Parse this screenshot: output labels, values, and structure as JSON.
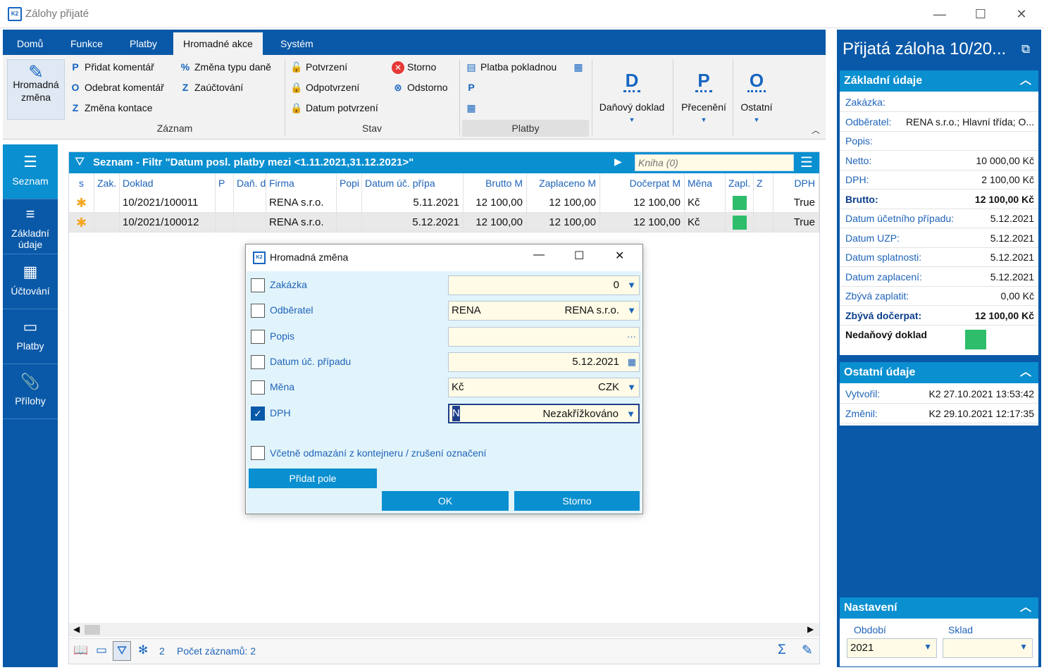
{
  "window": {
    "title": "Zálohy přijaté",
    "minimize": "—",
    "maximize": "☐",
    "close": "✕"
  },
  "tabs": [
    "Domů",
    "Funkce",
    "Platby",
    "Hromadné akce",
    "Systém"
  ],
  "ribbon": {
    "big_button": "Hromadná změna",
    "zaznam": [
      "Přidat komentář",
      "Odebrat komentář",
      "Změna kontace",
      "Změna typu daně",
      "Zaúčtování"
    ],
    "zaznam_label": "Záznam",
    "stav": [
      "Potvrzení",
      "Odpotvrzení",
      "Datum potvrzení",
      "Storno",
      "Odstorno"
    ],
    "stav_label": "Stav",
    "platby": [
      "Platba pokladnou"
    ],
    "platby_label": "Platby",
    "danovy": "Daňový doklad",
    "preceneni": "Přecenění",
    "ostatni": "Ostatní"
  },
  "leftnav": [
    "Seznam",
    "Základní údaje",
    "Účtování",
    "Platby",
    "Přílohy"
  ],
  "list": {
    "filter_title": "Seznam - Filtr \"Datum posl. platby mezi <1.11.2021,31.12.2021>\"",
    "search_placeholder": "Kniha (0)",
    "columns": [
      "s",
      "Zak.",
      "Doklad",
      "P",
      "Daň. dol",
      "Firma",
      "Popi",
      "Datum úč. přípa",
      "Brutto M",
      "Zaplaceno M",
      "Dočerpat M",
      "Měna",
      "Zapl.",
      "Z",
      "DPH"
    ],
    "rows": [
      {
        "doklad": "10/2021/100011",
        "firma": "RENA s.r.o.",
        "datum": "5.11.2021",
        "brutto": "12 100,00",
        "zaplaceno": "12 100,00",
        "docerpat": "12 100,00",
        "mena": "Kč",
        "dph": "True"
      },
      {
        "doklad": "10/2021/100012",
        "firma": "RENA s.r.o.",
        "datum": "5.12.2021",
        "brutto": "12 100,00",
        "zaplaceno": "12 100,00",
        "docerpat": "12 100,00",
        "mena": "Kč",
        "dph": "True"
      }
    ],
    "status_count": "2",
    "status_text": "Počet záznamů: 2"
  },
  "rpanel": {
    "title": "Přijatá záloha 10/20...",
    "zakladni_label": "Základní údaje",
    "zakladni": [
      {
        "k": "Zakázka:",
        "v": ""
      },
      {
        "k": "Odběratel:",
        "v": "RENA s.r.o.; Hlavní třída; O..."
      },
      {
        "k": "Popis:",
        "v": ""
      },
      {
        "k": "Netto:",
        "v": "10 000,00 Kč"
      },
      {
        "k": "DPH:",
        "v": "2 100,00 Kč"
      },
      {
        "k": "Brutto:",
        "v": "12 100,00 Kč"
      },
      {
        "k": "Datum účetního případu:",
        "v": "5.12.2021"
      },
      {
        "k": "Datum UZP:",
        "v": "5.12.2021"
      },
      {
        "k": "Datum splatnosti:",
        "v": "5.12.2021"
      },
      {
        "k": "Datum zaplacení:",
        "v": "5.12.2021"
      },
      {
        "k": "Zbývá zaplatit:",
        "v": "0,00 Kč"
      },
      {
        "k": "Zbývá dočerpat:",
        "v": "12 100,00 Kč"
      }
    ],
    "nedanovy": "Nedaňový doklad",
    "ostatni_label": "Ostatní údaje",
    "ostatni": [
      {
        "k": "Vytvořil:",
        "v": "K2 27.10.2021 13:53:42"
      },
      {
        "k": "Změnil:",
        "v": "K2 29.10.2021 12:17:35"
      }
    ],
    "nastaveni_label": "Nastavení",
    "obdobi_label": "Období",
    "obdobi": "2021",
    "sklad_label": "Sklad",
    "sklad": ""
  },
  "dialog": {
    "title": "Hromadná změna",
    "fields": [
      {
        "label": "Zakázka",
        "checked": false,
        "left": "",
        "right": "0",
        "icon": "dropdown"
      },
      {
        "label": "Odběratel",
        "checked": false,
        "left": "RENA",
        "right": "RENA s.r.o.",
        "icon": "dropdown"
      },
      {
        "label": "Popis",
        "checked": false,
        "left": "",
        "right": "",
        "icon": "ellipsis"
      },
      {
        "label": "Datum úč. případu",
        "checked": false,
        "left": "",
        "right": "5.12.2021",
        "icon": "calendar"
      },
      {
        "label": "Měna",
        "checked": false,
        "left": "Kč",
        "right": "CZK",
        "icon": "dropdown"
      },
      {
        "label": "DPH",
        "checked": true,
        "left": "N",
        "right": "Nezakřížkováno",
        "icon": "dropdown"
      }
    ],
    "include_label": "Včetně odmazání z kontejneru / zrušení označení",
    "add_field": "Přidat pole",
    "ok": "OK",
    "cancel": "Storno"
  }
}
